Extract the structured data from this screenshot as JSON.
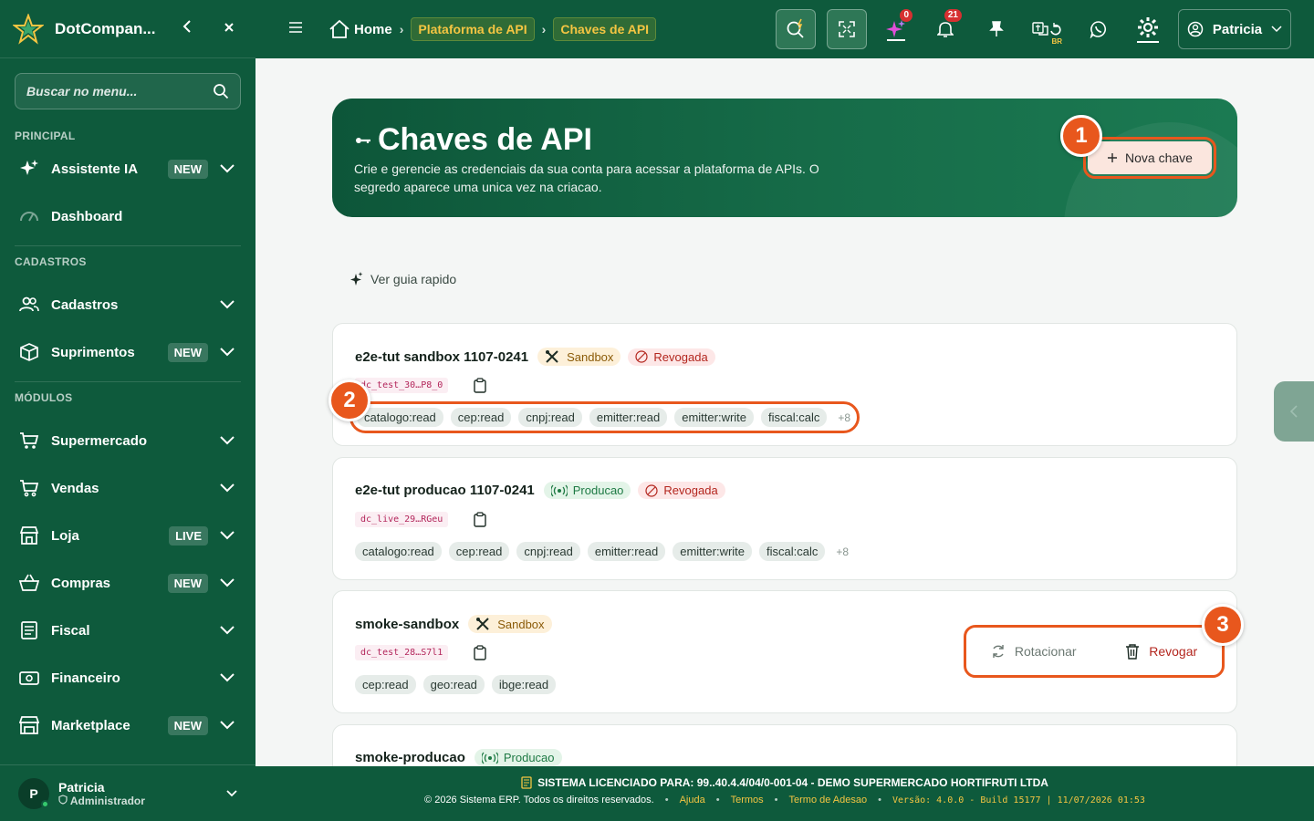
{
  "sidebar": {
    "brand": "DotCompan...",
    "search_placeholder": "Buscar no menu...",
    "sections": {
      "principal": "PRINCIPAL",
      "cadastros": "CADASTROS",
      "modulos": "MÓDULOS"
    },
    "items": [
      {
        "label": "Assistente IA",
        "badge": "NEW"
      },
      {
        "label": "Dashboard",
        "badge": ""
      },
      {
        "label": "Cadastros",
        "badge": ""
      },
      {
        "label": "Suprimentos",
        "badge": "NEW"
      },
      {
        "label": "Supermercado",
        "badge": ""
      },
      {
        "label": "Vendas",
        "badge": ""
      },
      {
        "label": "Loja",
        "badge": "LIVE"
      },
      {
        "label": "Compras",
        "badge": "NEW"
      },
      {
        "label": "Fiscal",
        "badge": ""
      },
      {
        "label": "Financeiro",
        "badge": ""
      },
      {
        "label": "Marketplace",
        "badge": "NEW"
      }
    ],
    "user": {
      "initial": "P",
      "name": "Patricia",
      "role": "Administrador"
    }
  },
  "topbar": {
    "breadcrumb": {
      "home": "Home",
      "level1": "Plataforma de API",
      "level2": "Chaves de API"
    },
    "ai_badge": "0",
    "notifications_badge": "21",
    "region_label": "BR",
    "user_name": "Patricia"
  },
  "hero": {
    "title": "Chaves de API",
    "description": "Crie e gerencie as credenciais da sua conta para acessar a plataforma de APIs. O segredo aparece uma unica vez na criacao.",
    "new_key_label": "Nova chave"
  },
  "guide_link": "Ver guia rapido",
  "keys": [
    {
      "name": "e2e-tut sandbox 1107-0241",
      "env": "Sandbox",
      "status": "Revogada",
      "prefix": "dc_test_30…P8_0",
      "scopes": [
        "catalogo:read",
        "cep:read",
        "cnpj:read",
        "emitter:read",
        "emitter:write",
        "fiscal:calc"
      ],
      "more": "+8"
    },
    {
      "name": "e2e-tut producao 1107-0241",
      "env": "Producao",
      "status": "Revogada",
      "prefix": "dc_live_29…RGeu",
      "scopes": [
        "catalogo:read",
        "cep:read",
        "cnpj:read",
        "emitter:read",
        "emitter:write",
        "fiscal:calc"
      ],
      "more": "+8"
    },
    {
      "name": "smoke-sandbox",
      "env": "Sandbox",
      "status": "",
      "prefix": "dc_test_28…S7l1",
      "scopes": [
        "cep:read",
        "geo:read",
        "ibge:read"
      ],
      "more": "",
      "actions": {
        "rotate": "Rotacionar",
        "revoke": "Revogar"
      }
    },
    {
      "name": "smoke-producao",
      "env": "Producao",
      "status": ""
    }
  ],
  "markers": [
    "1",
    "2",
    "3"
  ],
  "footer": {
    "license": "SISTEMA LICENCIADO PARA: 99..40.4.4/04/0-001-04 - DEMO SUPERMERCADO HORTIFRUTI LTDA",
    "copyright": "© 2026 Sistema ERP. Todos os direitos reservados.",
    "links": [
      "Ajuda",
      "Termos",
      "Termo de Adesao"
    ],
    "version": "Versão: 4.0.0 - Build 15177 | 11/07/2026 01:53"
  },
  "colors": {
    "brand_green": "#0e5a3c",
    "accent_orange": "#e8571d",
    "gold": "#f4c542"
  }
}
